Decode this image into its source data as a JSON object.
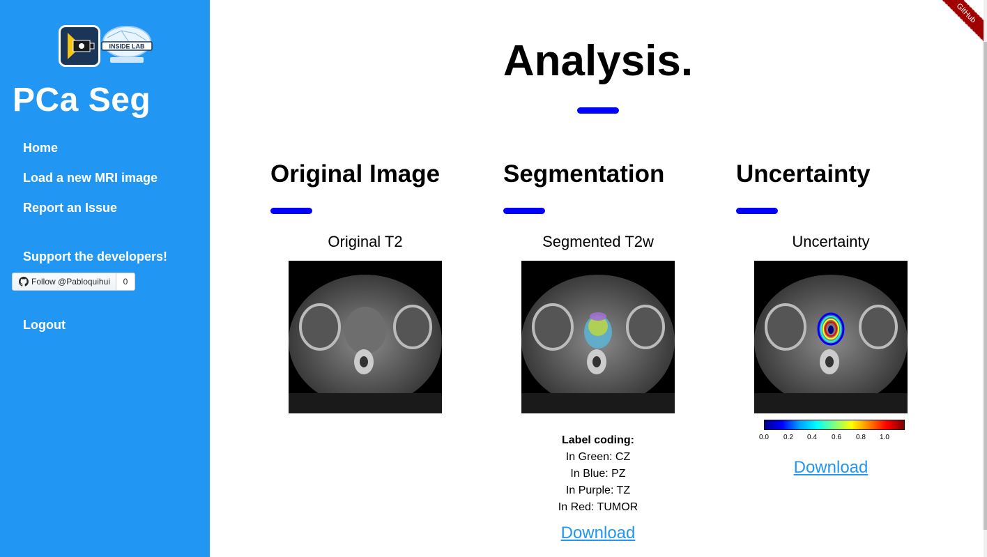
{
  "sidebar": {
    "app_title": "PCa Seg",
    "logo_text": "INSIDE LAB",
    "nav": {
      "home": "Home",
      "load": "Load a new MRI image",
      "report": "Report an Issue",
      "support": "Support the developers!",
      "logout": "Logout"
    },
    "github_follow": {
      "label": "Follow @Pabloquihui",
      "count": "0"
    },
    "color": "#2196f3"
  },
  "ribbon": "GitHub",
  "main": {
    "title": "Analysis.",
    "accent": "#0000ff",
    "columns": [
      {
        "heading": "Original Image",
        "caption": "Original T2"
      },
      {
        "heading": "Segmentation",
        "caption": "Segmented T2w"
      },
      {
        "heading": "Uncertainty",
        "caption": "Uncertainty"
      }
    ],
    "label_coding": {
      "title": "Label coding:",
      "lines": [
        "In Green: CZ",
        "In Blue: PZ",
        "In Purple: TZ",
        "In Red: TUMOR"
      ]
    },
    "colorbar_ticks": [
      "0.0",
      "0.2",
      "0.4",
      "0.6",
      "0.8",
      "1.0"
    ],
    "download": "Download"
  }
}
